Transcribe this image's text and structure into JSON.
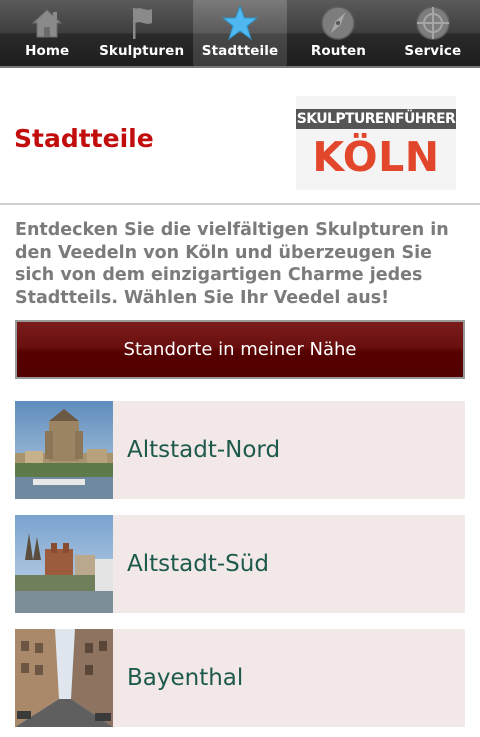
{
  "tabs": [
    {
      "label": "Home",
      "icon": "home-icon",
      "active": false
    },
    {
      "label": "Skulpturen",
      "icon": "flag-icon",
      "active": false
    },
    {
      "label": "Stadtteile",
      "icon": "star-icon",
      "active": true
    },
    {
      "label": "Routen",
      "icon": "compass-icon",
      "active": false
    },
    {
      "label": "Service",
      "icon": "crosshair-icon",
      "active": false
    }
  ],
  "header": {
    "title": "Stadtteile",
    "logo": {
      "line1": "SKULPTURENFÜHRER",
      "line2": "KÖLN"
    }
  },
  "intro": "Entdecken Sie die vielfältigen Skulpturen in den Veedeln von Köln und überzeugen Sie sich von dem einzigartigen Charme jedes Stadtteils. Wählen Sie Ihr Veedel aus!",
  "nearby_button": "Standorte in meiner Nähe",
  "districts": [
    {
      "name": "Altstadt-Nord"
    },
    {
      "name": "Altstadt-Süd"
    },
    {
      "name": "Bayenthal"
    }
  ],
  "colors": {
    "title_red": "#c20d0d",
    "button_bg": "#5c0000",
    "district_text": "#1e5a4c",
    "district_bg": "#f2e8e8",
    "active_icon": "#4fb8f0"
  }
}
